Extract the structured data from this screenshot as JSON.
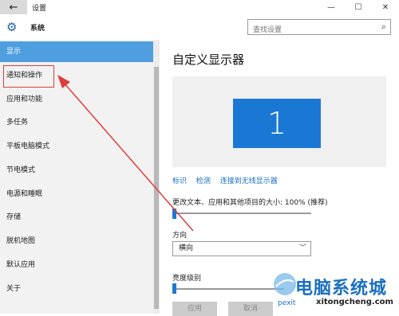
{
  "window": {
    "title": "设置",
    "back_icon": "←",
    "minimize_icon": "—",
    "maximize_icon": "☐",
    "close_icon": "✕"
  },
  "header": {
    "section_title": "系统",
    "search_placeholder": "查找设置"
  },
  "sidebar": {
    "items": [
      {
        "label": "显示",
        "active": true
      },
      {
        "label": "通知和操作",
        "active": false
      },
      {
        "label": "应用和功能",
        "active": false
      },
      {
        "label": "多任务",
        "active": false
      },
      {
        "label": "平板电脑模式",
        "active": false
      },
      {
        "label": "节电模式",
        "active": false
      },
      {
        "label": "电源和睡眠",
        "active": false
      },
      {
        "label": "存储",
        "active": false
      },
      {
        "label": "脱机地图",
        "active": false
      },
      {
        "label": "默认应用",
        "active": false
      },
      {
        "label": "关于",
        "active": false
      }
    ]
  },
  "main": {
    "title": "自定义显示器",
    "monitor_number": "1",
    "links": {
      "identify": "标识",
      "detect": "检测",
      "wireless": "连接到无线显示器"
    },
    "scale_label": "更改文本、应用和其他项目的大小: 100% (推荐)",
    "scale_value_percent": 100,
    "orientation_label": "方向",
    "orientation_value": "横向",
    "brightness_label": "亮度级别",
    "brightness_level": 0,
    "apply_button": "应用",
    "cancel_button": "取消"
  },
  "watermark": {
    "brand": "电脑系统城",
    "url": "xitongcheng.com",
    "prefix": "pexit"
  },
  "colors": {
    "accent": "#1a78d4",
    "active_nav": "#4f9fe0",
    "annotation_red": "#e03c3c"
  }
}
